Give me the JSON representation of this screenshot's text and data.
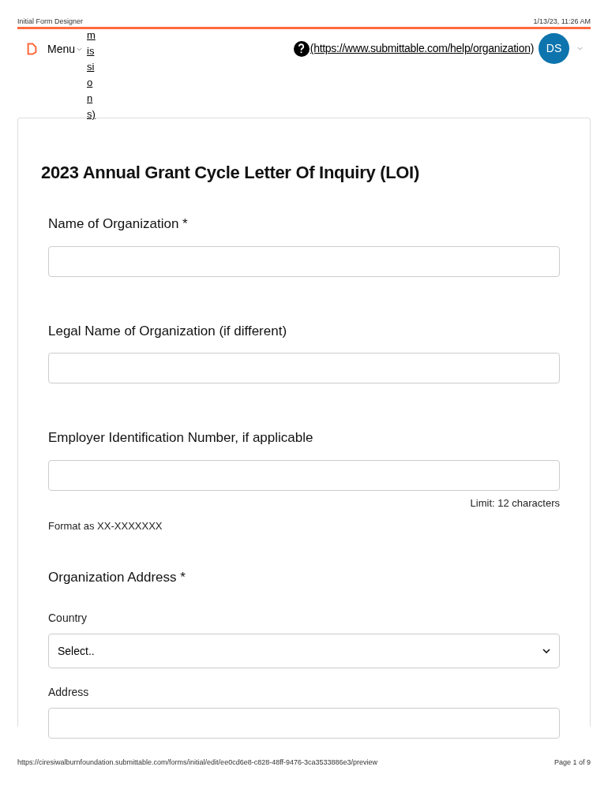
{
  "print_header": {
    "title": "Initial Form Designer",
    "datetime": "1/13/23, 11:26 AM"
  },
  "nav": {
    "menu": "Menu",
    "overflow_link": "missions)",
    "help_link": "(https://www.submittable.com/help/organization)",
    "avatar": "DS"
  },
  "form": {
    "title": "2023 Annual Grant Cycle Letter Of Inquiry (LOI)",
    "fields": [
      {
        "kind": "text",
        "label": "Name of Organization *"
      },
      {
        "kind": "text",
        "label": "Legal Name of Organization (if different)"
      },
      {
        "kind": "text",
        "label": "Employer Identification Number, if applicable",
        "limit": "Limit: 12 characters",
        "help": "Format as XX-XXXXXXX"
      },
      {
        "kind": "heading",
        "label": "Organization Address *"
      },
      {
        "kind": "select",
        "label": "Country",
        "placeholder": "Select.."
      },
      {
        "kind": "text",
        "label": "Address",
        "small": true
      }
    ]
  },
  "print_footer": {
    "url": "https://ciresiwalburnfoundation.submittable.com/forms/initial/edit/ee0cd6e8-c828-48ff-9476-3ca3533886e3/preview",
    "page": "Page 1 of 9"
  }
}
